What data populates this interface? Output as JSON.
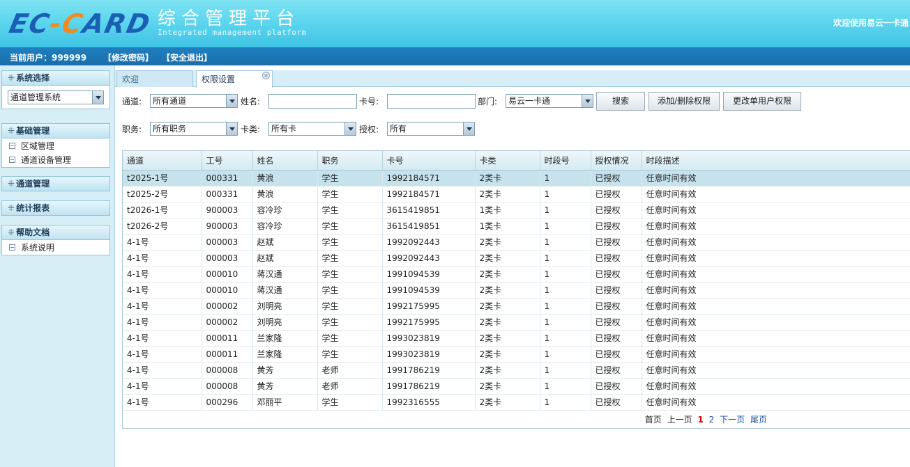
{
  "header": {
    "logo": {
      "part1": "EC",
      "dash": "-",
      "part2": "C",
      "part3": "ARD"
    },
    "title_zh": "综合管理平台",
    "title_en": "Integrated management platform",
    "welcome": "欢迎使用易云一卡通"
  },
  "userbar": {
    "current_user": "当前用户：999999",
    "change_password": "【修改密码】",
    "logout": "【安全退出】"
  },
  "sidebar": {
    "system_select": {
      "title": "系统选择",
      "value": "通道管理系统"
    },
    "basic": {
      "title": "基础管理",
      "items": [
        "区域管理",
        "通道设备管理"
      ]
    },
    "channel": {
      "title": "通道管理"
    },
    "report": {
      "title": "统计报表"
    },
    "help": {
      "title": "帮助文档",
      "items": [
        "系统说明"
      ]
    }
  },
  "tabs": {
    "welcome": "欢迎",
    "permission": "权限设置",
    "close": "×"
  },
  "filters": {
    "channel_label": "通道:",
    "channel_value": "所有通道",
    "name_label": "姓名:",
    "name_value": "",
    "card_label": "卡号:",
    "card_value": "",
    "dept_label": "部门:",
    "dept_value": "易云一卡通",
    "search_btn": "搜索",
    "add_remove_btn": "添加/删除权限",
    "change_single_btn": "更改单用户权限",
    "job_label": "职务:",
    "job_value": "所有职务",
    "cardtype_label": "卡类:",
    "cardtype_value": "所有卡",
    "auth_label": "授权:",
    "auth_value": "所有"
  },
  "table": {
    "columns": [
      "通道",
      "工号",
      "姓名",
      "职务",
      "卡号",
      "卡类",
      "时段号",
      "授权情况",
      "时段描述"
    ],
    "rows": [
      [
        "t2025-1号",
        "000331",
        "黄浪",
        "学生",
        "1992184571",
        "2类卡",
        "1",
        "已授权",
        "任意时间有效"
      ],
      [
        "t2025-2号",
        "000331",
        "黄浪",
        "学生",
        "1992184571",
        "2类卡",
        "1",
        "已授权",
        "任意时间有效"
      ],
      [
        "t2026-1号",
        "900003",
        "容冷珍",
        "学生",
        "3615419851",
        "1类卡",
        "1",
        "已授权",
        "任意时间有效"
      ],
      [
        "t2026-2号",
        "900003",
        "容冷珍",
        "学生",
        "3615419851",
        "1类卡",
        "1",
        "已授权",
        "任意时间有效"
      ],
      [
        "4-1号",
        "000003",
        "赵斌",
        "学生",
        "1992092443",
        "2类卡",
        "1",
        "已授权",
        "任意时间有效"
      ],
      [
        "4-1号",
        "000003",
        "赵斌",
        "学生",
        "1992092443",
        "2类卡",
        "1",
        "已授权",
        "任意时间有效"
      ],
      [
        "4-1号",
        "000010",
        "蒋汉通",
        "学生",
        "1991094539",
        "2类卡",
        "1",
        "已授权",
        "任意时间有效"
      ],
      [
        "4-1号",
        "000010",
        "蒋汉通",
        "学生",
        "1991094539",
        "2类卡",
        "1",
        "已授权",
        "任意时间有效"
      ],
      [
        "4-1号",
        "000002",
        "刘明亮",
        "学生",
        "1992175995",
        "2类卡",
        "1",
        "已授权",
        "任意时间有效"
      ],
      [
        "4-1号",
        "000002",
        "刘明亮",
        "学生",
        "1992175995",
        "2类卡",
        "1",
        "已授权",
        "任意时间有效"
      ],
      [
        "4-1号",
        "000011",
        "兰家隆",
        "学生",
        "1993023819",
        "2类卡",
        "1",
        "已授权",
        "任意时间有效"
      ],
      [
        "4-1号",
        "000011",
        "兰家隆",
        "学生",
        "1993023819",
        "2类卡",
        "1",
        "已授权",
        "任意时间有效"
      ],
      [
        "4-1号",
        "000008",
        "黄芳",
        "老师",
        "1991786219",
        "2类卡",
        "1",
        "已授权",
        "任意时间有效"
      ],
      [
        "4-1号",
        "000008",
        "黄芳",
        "老师",
        "1991786219",
        "2类卡",
        "1",
        "已授权",
        "任意时间有效"
      ],
      [
        "4-1号",
        "000296",
        "邓丽平",
        "学生",
        "1992316555",
        "2类卡",
        "1",
        "已授权",
        "任意时间有效"
      ]
    ]
  },
  "pager": {
    "first": "首页",
    "prev": "上一页",
    "pages": [
      "1",
      "2"
    ],
    "current": "1",
    "next": "下一页",
    "last": "尾页"
  }
}
